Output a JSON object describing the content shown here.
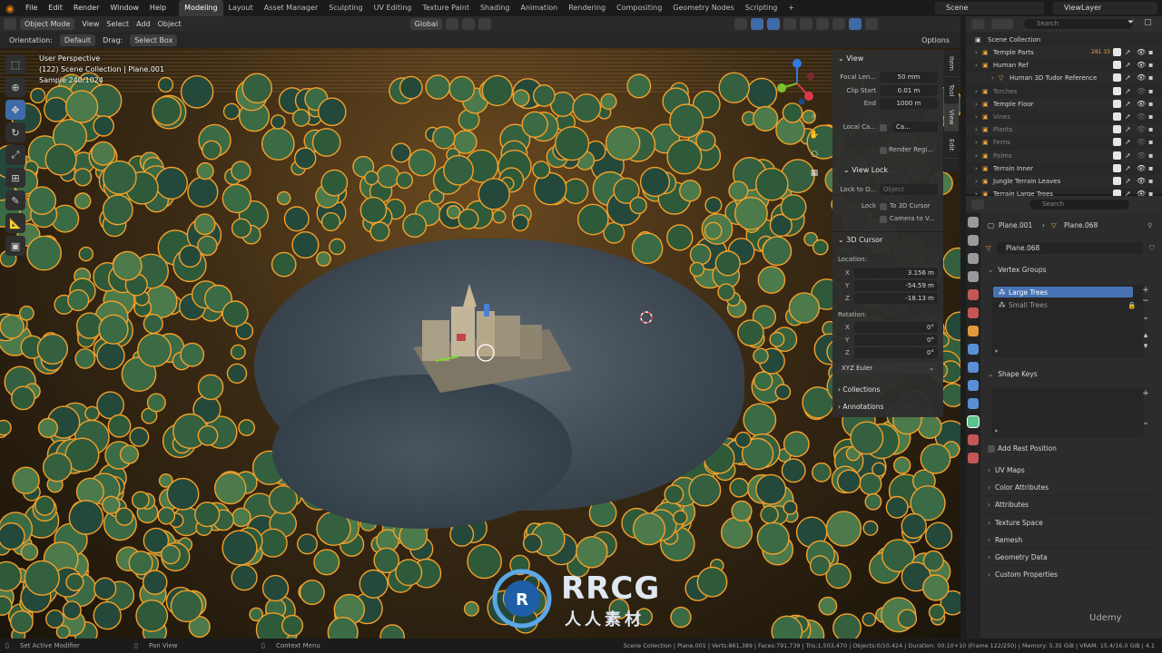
{
  "menubar": {
    "items": [
      "File",
      "Edit",
      "Render",
      "Window",
      "Help"
    ],
    "workspaces": [
      "Modeling",
      "Layout",
      "Asset Manager",
      "Sculpting",
      "UV Editing",
      "Texture Paint",
      "Shading",
      "Animation",
      "Rendering",
      "Compositing",
      "Geometry Nodes",
      "Scripting"
    ],
    "active_workspace": "Modeling",
    "add_tab": "+",
    "scene": "Scene",
    "view_layer": "ViewLayer"
  },
  "viewport_header": {
    "mode": "Object Mode",
    "menus": [
      "View",
      "Select",
      "Add",
      "Object"
    ],
    "transform": "Global",
    "orientation_label": "Orientation:",
    "orientation_value": "Default",
    "drag_label": "Drag:",
    "drag_value": "Select Box",
    "options": "Options"
  },
  "viewport_overlay": {
    "line1": "User Perspective",
    "line2": "(122) Scene Collection | Plane.001",
    "line3": "Sample 240/1024"
  },
  "npanel": {
    "tabs": [
      "Item",
      "Tool",
      "View",
      "Edit"
    ],
    "view_title": "View",
    "focal_label": "Focal Len...",
    "focal_value": "50 mm",
    "clip_start_label": "Clip Start",
    "clip_start_value": "0.01 m",
    "end_label": "End",
    "end_value": "1000 m",
    "local_camera_label": "Local Ca...",
    "local_camera_value": "Ca...",
    "render_region": "Render Regi...",
    "view_lock_title": "View Lock",
    "lock_to_label": "Lock to O...",
    "lock_to_value": "Object",
    "lock_label": "Lock",
    "to_cursor": "To 3D Cursor",
    "camera_to_view": "Camera to V...",
    "cursor_title": "3D Cursor",
    "location_label": "Location:",
    "x_label": "X",
    "x_value": "3.156 m",
    "y_label": "Y",
    "y_value": "-54.59 m",
    "z_label": "Z",
    "z_value": "-18.13 m",
    "rotation_label": "Rotation:",
    "rx_value": "0°",
    "ry_value": "0°",
    "rz_value": "0°",
    "euler": "XYZ Euler",
    "collections": "Collections",
    "annotations": "Annotations"
  },
  "outliner": {
    "search_placeholder": "Search",
    "root": "Scene Collection",
    "rows": [
      {
        "name": "Temple Parts",
        "badge": "281 33",
        "dim": false
      },
      {
        "name": "Human Ref",
        "badge": "",
        "dim": false
      },
      {
        "name": "Human 3D Tudor Reference",
        "badge": "",
        "dim": false
      },
      {
        "name": "Torches",
        "badge": "",
        "dim": true
      },
      {
        "name": "Temple Floor",
        "badge": "",
        "dim": false
      },
      {
        "name": "Vines",
        "badge": "",
        "dim": true
      },
      {
        "name": "Plants",
        "badge": "",
        "dim": true
      },
      {
        "name": "Ferns",
        "badge": "",
        "dim": true
      },
      {
        "name": "Palms",
        "badge": "",
        "dim": true
      },
      {
        "name": "Terrain Inner",
        "badge": "",
        "dim": false
      },
      {
        "name": "Jungle Terrain Leaves",
        "badge": "",
        "dim": false
      },
      {
        "name": "Terrain Large Trees",
        "badge": "",
        "dim": false
      }
    ]
  },
  "properties": {
    "search_placeholder": "Search",
    "breadcrumb_object": "Plane.001",
    "breadcrumb_mesh": "Plane.068",
    "mesh_name": "Plane.068",
    "vertex_groups": "Vertex Groups",
    "vg_items": [
      "Large Trees",
      "Small Trees"
    ],
    "shape_keys": "Shape Keys",
    "add_rest_position": "Add Rest Position",
    "sections": [
      "UV Maps",
      "Color Attributes",
      "Attributes",
      "Texture Space",
      "Remesh",
      "Geometry Data",
      "Custom Properties"
    ]
  },
  "statusbar": {
    "left1": "Set Active Modifier",
    "left2": "Pan View",
    "left3": "Context Menu",
    "stats": "Scene Collection | Plane.001 | Verts:861,389 | Faces:791,739 | Tris:1,503,470 | Objects:0/10,424 | Duration: 00:10+10 (Frame 122/250) | Memory: 5.35 GiB | VRAM: 15.4/16.0 GiB | 4.1"
  },
  "watermark": {
    "brand": "RRCG",
    "sub": "人人素材",
    "udemy": "Udemy"
  },
  "colors": {
    "accent": "#e87d0d",
    "selection": "#4772b3",
    "outline": "#f5a02a"
  }
}
